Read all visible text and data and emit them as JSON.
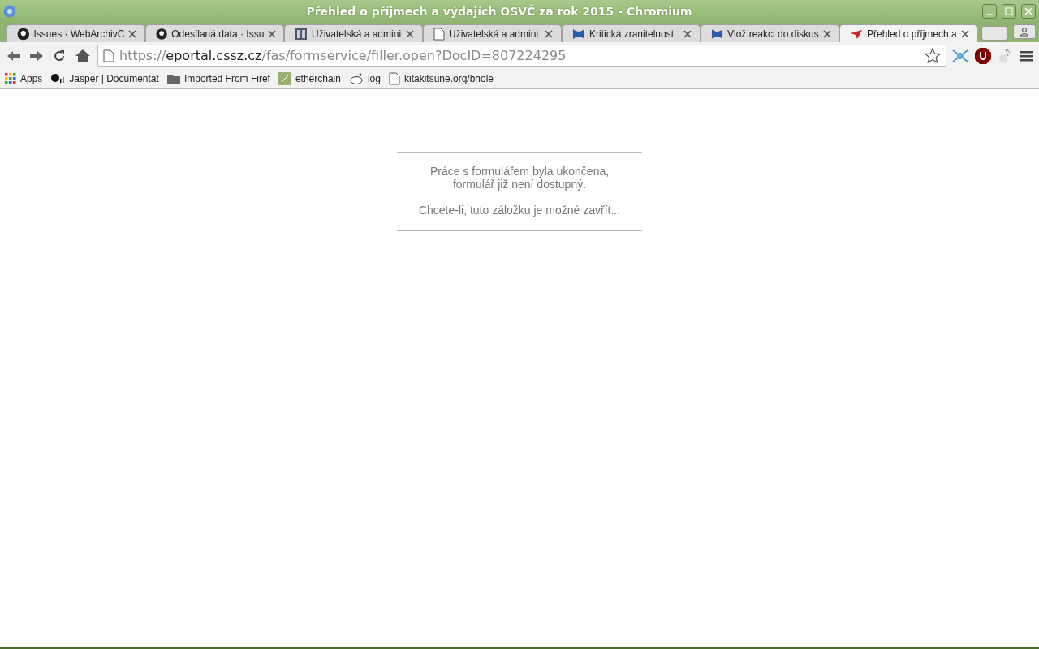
{
  "window": {
    "title": "Přehled o příjmech a výdajích OSVČ za rok 2015 - Chromium"
  },
  "tabs": [
    {
      "label": "Issues · WebArchivC",
      "selected": false
    },
    {
      "label": "Odesílaná data · Issu",
      "selected": false
    },
    {
      "label": "Uživatelská a admini",
      "selected": false
    },
    {
      "label": "Uživatelská a admini",
      "selected": false
    },
    {
      "label": "Kritická zranitelnost",
      "selected": false
    },
    {
      "label": "Vlož reakci do diskus",
      "selected": false
    },
    {
      "label": "Přehled o příjmech a",
      "selected": true
    }
  ],
  "address": {
    "scheme": "https://",
    "host": "eportal.cssz.cz",
    "path": "/fas/formservice/filler.open?DocID=807224295"
  },
  "bookmarks": [
    "Apps",
    "Jasper | Documentat",
    "Imported From Firef",
    "etherchain",
    "log",
    "kitakitsune.org/bhole"
  ],
  "message": {
    "lines": [
      "Práce s formulářem byla ukončena,",
      "formulář již není dostupný."
    ],
    "hint": "Chcete-li, tuto záložku je možné zavřít..."
  }
}
